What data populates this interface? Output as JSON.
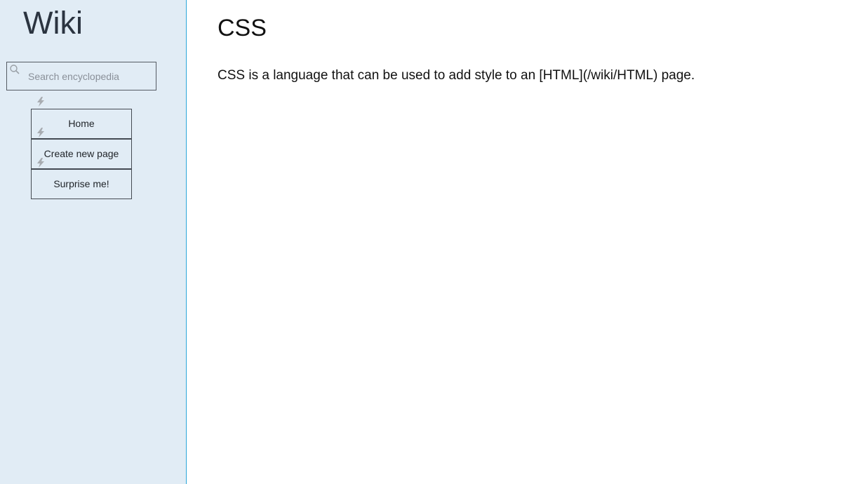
{
  "sidebar": {
    "logo": "Wiki",
    "search": {
      "placeholder": "Search encyclopedia",
      "value": ""
    },
    "nav": [
      {
        "label": "Home"
      },
      {
        "label": "Create new page"
      },
      {
        "label": "Surprise me!"
      }
    ]
  },
  "article": {
    "title": "CSS",
    "body": "CSS is a language that can be used to add style to an [HTML](/wiki/HTML) page."
  },
  "colors": {
    "sidebar_bg": "#e1ecf5",
    "divider": "#2aa6d9",
    "text": "#111111"
  },
  "icons": [
    "search-icon",
    "bolt-icon"
  ]
}
